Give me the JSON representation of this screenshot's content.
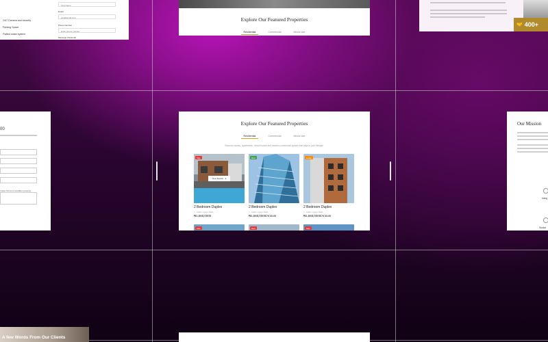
{
  "center": {
    "title": "Explore Our Featured Properties",
    "tabs": [
      "Residential",
      "Commercial",
      "Mixed Use"
    ],
    "description": "Discover homes, apartments, rental houses and modern commercial spaces that align to your lifestyle.",
    "view_button": "View Details",
    "properties": [
      {
        "badge": "Sale",
        "badge_color": "#e53935",
        "title": "2 Bedroom Duplex",
        "location": "Lekki, Lagos State",
        "price": "₦1,560,0000"
      },
      {
        "badge": "Rent",
        "badge_color": "#43a047",
        "title": "2 Bedroom Duplex",
        "location": "Lekki, Lagos State",
        "price": "₦1,560,0000/Annum"
      },
      {
        "badge": "Lease",
        "badge_color": "#fb8c00",
        "title": "2 Bedroom Duplex",
        "location": "Lekki, Lagos State",
        "price": "₦1,560,0000/Annum"
      }
    ],
    "row2_badges": [
      "Sale",
      "Rent",
      "Sale"
    ]
  },
  "top_card": {
    "title": "Explore Our Featured Properties",
    "tabs": [
      "Residential",
      "Commercial",
      "Mixed Use"
    ]
  },
  "form": {
    "first_name_placeholder": "First Name",
    "email_label": "Email",
    "email_placeholder": "you@email.com",
    "phone_label": "Phone Number",
    "phone_placeholder": "Enter phone number",
    "message_label": "Message (Optional)",
    "features": [
      "24/7 Camera and security",
      "Parking Space",
      "Flatted water system"
    ]
  },
  "left_mid": {
    "fragment": "00",
    "checkbox_text": "I have Terms & Condition properly"
  },
  "mission": {
    "title": "Our Mission",
    "side_words": [
      "Integ",
      "Sustai"
    ]
  },
  "top_right": {
    "stat_number": "400+"
  },
  "bottom": {
    "testimonials_title": "A few Words From Our Clients"
  },
  "colors": {
    "accent": "#c9a227",
    "stat_bg": "#b08a2c"
  }
}
